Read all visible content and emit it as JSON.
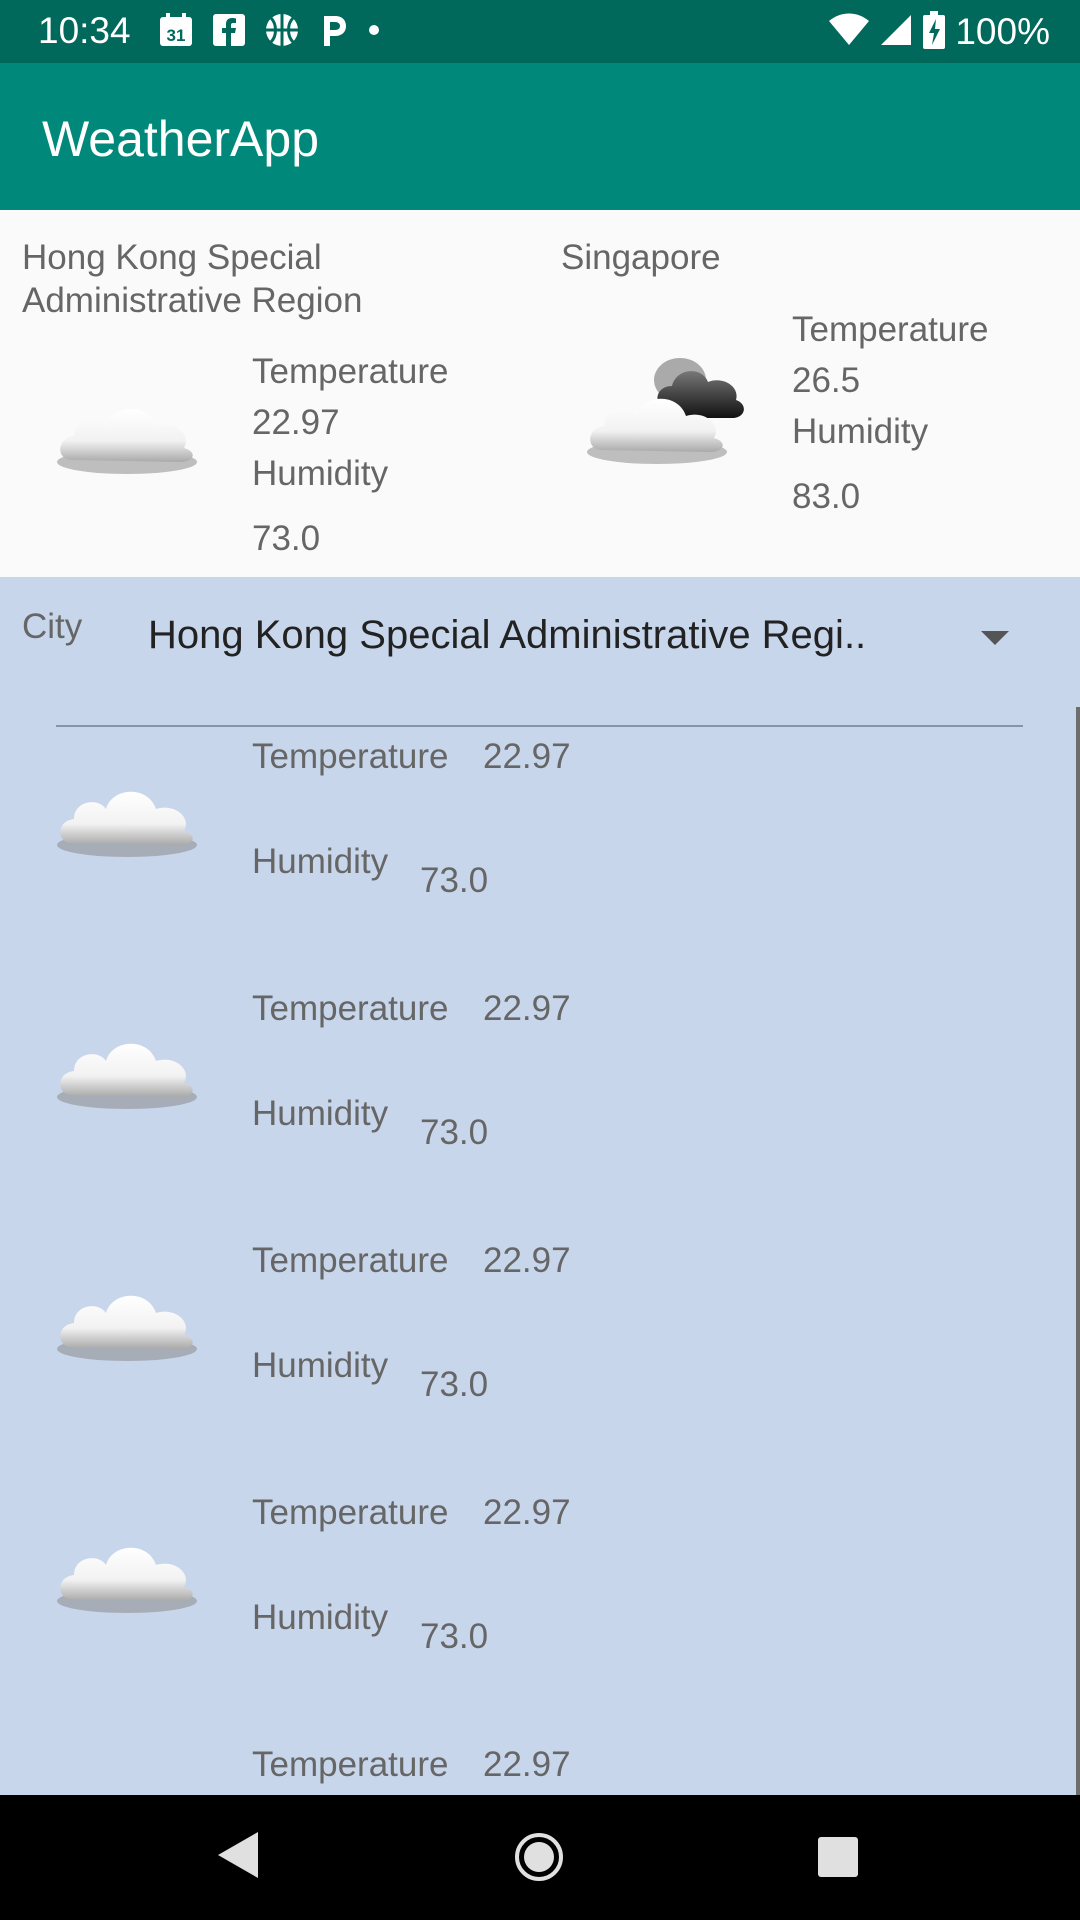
{
  "status_bar": {
    "time": "10:34",
    "battery_percent": "100%",
    "icons_left": [
      "calendar-icon",
      "facebook-icon",
      "basketball-icon",
      "parking-icon",
      "dot-icon"
    ],
    "icons_right": [
      "wifi-icon",
      "signal-icon",
      "battery-charging-icon"
    ],
    "calendar_day": "31"
  },
  "app_bar": {
    "title": "WeatherApp"
  },
  "summary": {
    "cards": [
      {
        "city": "Hong Kong Special Administrative Region",
        "temperature_label": "Temperature",
        "temperature": "22.97",
        "humidity_label": "Humidity",
        "humidity": "73.0",
        "icon": "cloud-icon"
      },
      {
        "city": "Singapore",
        "temperature_label": "Temperature",
        "temperature": "26.5",
        "humidity_label": "Humidity",
        "humidity": "83.0",
        "icon": "cloud-dark-cloud-icon"
      }
    ]
  },
  "city_select": {
    "label": "City",
    "selected": "Hong Kong Special Administrative Regi.."
  },
  "forecast_list": [
    {
      "temperature_label": "Temperature",
      "temperature": "22.97",
      "humidity_label": "Humidity",
      "humidity": "73.0"
    },
    {
      "temperature_label": "Temperature",
      "temperature": "22.97",
      "humidity_label": "Humidity",
      "humidity": "73.0"
    },
    {
      "temperature_label": "Temperature",
      "temperature": "22.97",
      "humidity_label": "Humidity",
      "humidity": "73.0"
    },
    {
      "temperature_label": "Temperature",
      "temperature": "22.97",
      "humidity_label": "Humidity",
      "humidity": "73.0"
    },
    {
      "temperature_label": "Temperature",
      "temperature": "22.97"
    }
  ],
  "nav_bar": {
    "buttons": [
      "back-icon",
      "home-icon",
      "recents-icon"
    ]
  },
  "colors": {
    "status_bar": "#00695c",
    "app_bar": "#00897b",
    "panel": "#c8d6ec",
    "text_secondary": "#666666"
  }
}
